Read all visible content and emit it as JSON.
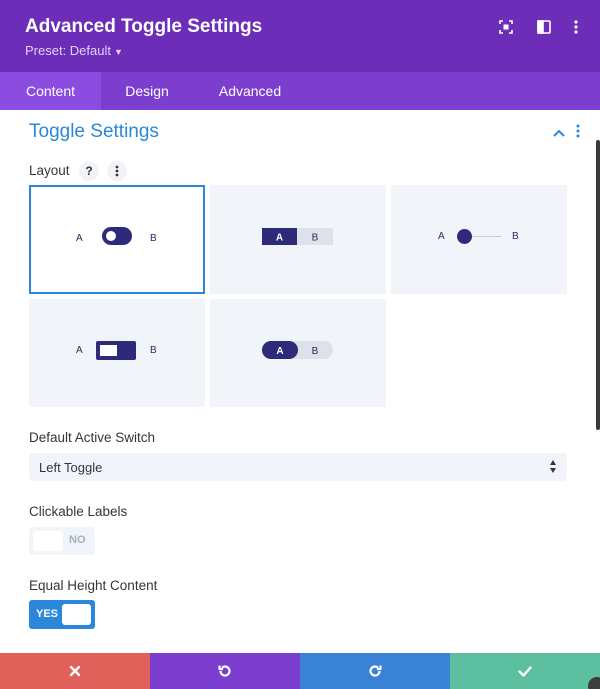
{
  "header": {
    "title": "Advanced Toggle Settings",
    "preset_label": "Preset: Default",
    "background": "#6c2eb9",
    "icons": [
      "focus-icon",
      "sidebar-layout-icon",
      "more-vertical-icon"
    ]
  },
  "tabs": [
    {
      "label": "Content",
      "active": true
    },
    {
      "label": "Design",
      "active": false
    },
    {
      "label": "Advanced",
      "active": false
    }
  ],
  "section": {
    "title": "Toggle Settings",
    "accent": "#2b87da"
  },
  "layout_field": {
    "label": "Layout",
    "help_label": "?",
    "options": [
      {
        "style": "pill-switch",
        "label_a": "A",
        "label_b": "B",
        "selected": true
      },
      {
        "style": "segmented-square",
        "label_a": "A",
        "label_b": "B",
        "selected": false
      },
      {
        "style": "slider-dot",
        "label_a": "A",
        "label_b": "B",
        "selected": false
      },
      {
        "style": "square-switch",
        "label_a": "A",
        "label_b": "B",
        "selected": false
      },
      {
        "style": "segmented-rounded",
        "label_a": "A",
        "label_b": "B",
        "selected": false
      }
    ],
    "switch_color": "#2e2a7a"
  },
  "default_active_switch": {
    "label": "Default Active Switch",
    "value": "Left Toggle"
  },
  "clickable_labels": {
    "label": "Clickable Labels",
    "state_text": "NO",
    "enabled": false
  },
  "equal_height": {
    "label": "Equal Height Content",
    "state_text": "YES",
    "enabled": true
  },
  "footer": {
    "buttons": [
      {
        "name": "discard-button",
        "icon": "close-icon",
        "color": "#e0605a"
      },
      {
        "name": "undo-button",
        "icon": "undo-icon",
        "color": "#7b3ecf"
      },
      {
        "name": "redo-button",
        "icon": "redo-icon",
        "color": "#3a82d6"
      },
      {
        "name": "save-button",
        "icon": "check-icon",
        "color": "#5cbf9f"
      }
    ]
  }
}
